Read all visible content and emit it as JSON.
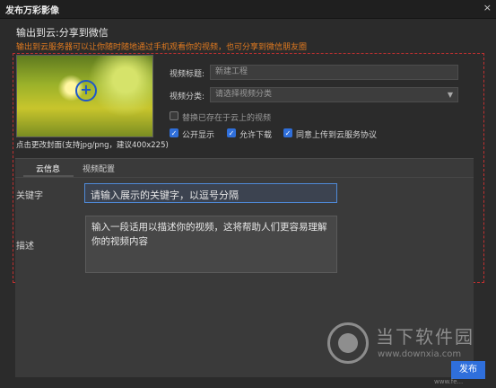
{
  "window": {
    "title": "发布万彩影像",
    "close_glyph": "×"
  },
  "header": {
    "heading": "输出到云:分享到微信",
    "subtitle": "输出到云服务器可以让你随时随地通过手机观看你的视频，也可分享到微信朋友圈"
  },
  "cover": {
    "hint": "点击更改封面(支持jpg/png，建议400x225)"
  },
  "form": {
    "title_label": "视频标题:",
    "title_placeholder": "新建工程",
    "category_label": "视频分类:",
    "category_value": "请选择视频分类",
    "replace_label": "替换已存在于云上的视频",
    "public_label": "公开显示",
    "download_label": "允许下载",
    "agree_label": "同意上传到云服务协议"
  },
  "tabs": [
    {
      "label": "云信息",
      "active": true
    },
    {
      "label": "视频配置",
      "active": false
    }
  ],
  "keywords": {
    "label": "关键字",
    "value": "请输入展示的关键字，以逗号分隔"
  },
  "description": {
    "label": "描述",
    "value": "输入一段话用以描述你的视频，这将帮助人们更容易理解你的视频内容"
  },
  "watermark": {
    "main": "当下软件园",
    "sub": "www.downxia.com"
  },
  "footer": {
    "publish_label": "发布",
    "url": "www.fe..."
  }
}
